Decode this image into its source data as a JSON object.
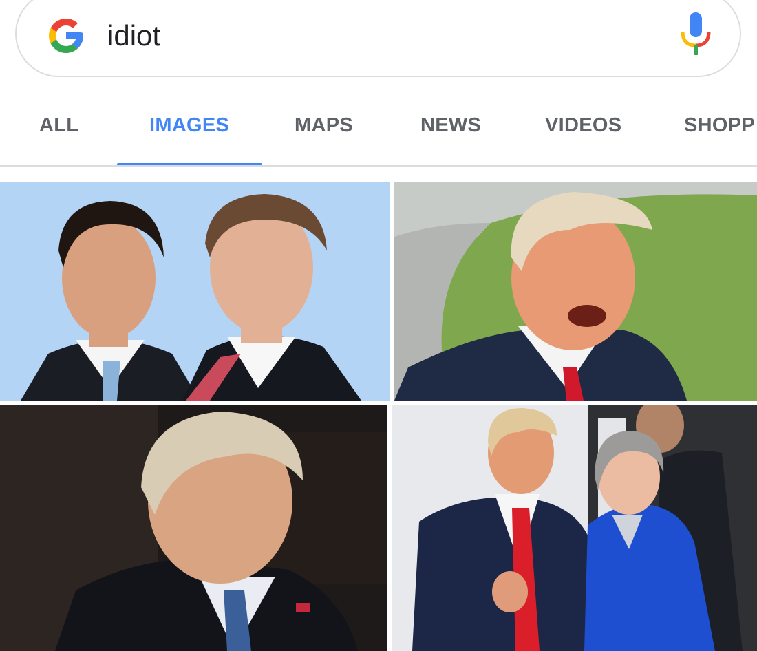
{
  "search": {
    "query": "idiot",
    "logo_icon": "google-g-icon",
    "mic_icon": "microphone-icon"
  },
  "tabs": [
    {
      "label": "ALL",
      "active": false
    },
    {
      "label": "IMAGES",
      "active": true
    },
    {
      "label": "MAPS",
      "active": false
    },
    {
      "label": "NEWS",
      "active": false
    },
    {
      "label": "VIDEOS",
      "active": false
    },
    {
      "label": "SHOPP",
      "active": false
    }
  ],
  "colors": {
    "accent": "#4285f4",
    "google_blue": "#4285f4",
    "google_red": "#ea4335",
    "google_yellow": "#fbbc05",
    "google_green": "#34a853",
    "tab_text": "#5f6368"
  },
  "image_results": [
    {
      "subject": "two men in suits with ties against light blue background"
    },
    {
      "subject": "man with blond hair in suit and red tie, outdoors on lawn"
    },
    {
      "subject": "man with blond hair in dark suit, blue striped tie, dark room"
    },
    {
      "subject": "man in suit with red tie giving thumbs up beside woman in blue jacket"
    }
  ]
}
